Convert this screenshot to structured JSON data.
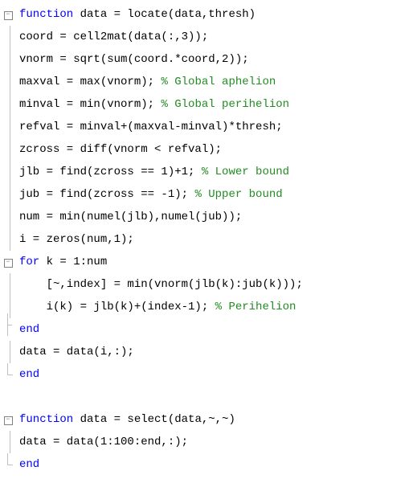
{
  "lines": [
    {
      "g": "fold",
      "segs": [
        {
          "c": "kw",
          "t": "function"
        },
        {
          "c": "plain",
          "t": " data = locate(data,thresh)"
        }
      ]
    },
    {
      "g": "rule",
      "segs": [
        {
          "c": "plain",
          "t": "coord = cell2mat(data(:,3));"
        }
      ]
    },
    {
      "g": "rule",
      "segs": [
        {
          "c": "plain",
          "t": "vnorm = sqrt(sum(coord.*coord,2));"
        }
      ]
    },
    {
      "g": "rule",
      "segs": [
        {
          "c": "plain",
          "t": "maxval = max(vnorm); "
        },
        {
          "c": "com",
          "t": "% Global aphelion"
        }
      ]
    },
    {
      "g": "rule",
      "segs": [
        {
          "c": "plain",
          "t": "minval = min(vnorm); "
        },
        {
          "c": "com",
          "t": "% Global perihelion"
        }
      ]
    },
    {
      "g": "rule",
      "segs": [
        {
          "c": "plain",
          "t": "refval = minval+(maxval-minval)*thresh;"
        }
      ]
    },
    {
      "g": "rule",
      "segs": [
        {
          "c": "plain",
          "t": "zcross = diff(vnorm < refval);"
        }
      ]
    },
    {
      "g": "rule",
      "segs": [
        {
          "c": "plain",
          "t": "jlb = find(zcross == 1)+1; "
        },
        {
          "c": "com",
          "t": "% Lower bound"
        }
      ]
    },
    {
      "g": "rule",
      "segs": [
        {
          "c": "plain",
          "t": "jub = find(zcross == -1); "
        },
        {
          "c": "com",
          "t": "% Upper bound"
        }
      ]
    },
    {
      "g": "rule",
      "segs": [
        {
          "c": "plain",
          "t": "num = min(numel(jlb),numel(jub));"
        }
      ]
    },
    {
      "g": "rule",
      "segs": [
        {
          "c": "plain",
          "t": "i = zeros(num,1);"
        }
      ]
    },
    {
      "g": "fold",
      "segs": [
        {
          "c": "kw",
          "t": "for"
        },
        {
          "c": "plain",
          "t": " k = 1:num"
        }
      ]
    },
    {
      "g": "rule",
      "segs": [
        {
          "c": "plain",
          "t": "    [~,index] = min(vnorm(jlb(k):jub(k)));"
        }
      ]
    },
    {
      "g": "rule",
      "segs": [
        {
          "c": "plain",
          "t": "    i(k) = jlb(k)+(index-1); "
        },
        {
          "c": "com",
          "t": "% Perihelion"
        }
      ]
    },
    {
      "g": "mid",
      "segs": [
        {
          "c": "kw",
          "t": "end"
        }
      ]
    },
    {
      "g": "rule",
      "segs": [
        {
          "c": "plain",
          "t": "data = data(i,:);"
        }
      ]
    },
    {
      "g": "end",
      "segs": [
        {
          "c": "kw",
          "t": "end"
        }
      ]
    },
    {
      "g": "blank",
      "segs": [
        {
          "c": "plain",
          "t": ""
        }
      ]
    },
    {
      "g": "fold",
      "segs": [
        {
          "c": "kw",
          "t": "function"
        },
        {
          "c": "plain",
          "t": " data = select(data,~,~)"
        }
      ]
    },
    {
      "g": "rule",
      "segs": [
        {
          "c": "plain",
          "t": "data = data(1:100:end,:);"
        }
      ]
    },
    {
      "g": "end",
      "segs": [
        {
          "c": "kw",
          "t": "end"
        }
      ]
    }
  ]
}
